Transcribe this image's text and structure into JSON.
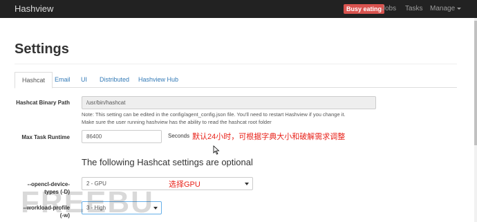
{
  "navbar": {
    "brand": "Hashview",
    "badge": "Busy eating",
    "links": {
      "jobs": "Jobs",
      "tasks": "Tasks",
      "manage": "Manage"
    }
  },
  "page": {
    "title": "Settings"
  },
  "tabs": [
    "Hashcat",
    "Email",
    "UI",
    "Distributed",
    "Hashview Hub"
  ],
  "form": {
    "binary_path": {
      "label": "Hashcat Binary Path",
      "value": "/usr/bin/hashcat",
      "help_line1": "Note: This setting can be edited in the config/agent_config.json file. You'll need to restart Hashview if you change it.",
      "help_line2": "Make sure the user running hashview has the ability to read the hashcat root folder"
    },
    "max_runtime": {
      "label": "Max Task Runtime",
      "value": "86400",
      "unit": "Seconds",
      "annotation": "默认24小时，可根据字典大小和破解需求调整"
    },
    "optional_heading": "The following Hashcat settings are optional",
    "device_types": {
      "label_line1": "--opencl-device-",
      "label_line2": "types (-D)",
      "value": "2 - GPU",
      "annotation": "选择GPU"
    },
    "workload": {
      "label_line1": "--workload-profile",
      "label_line2": "(-w)",
      "value": "3 - High"
    }
  },
  "watermark": "FREEBUF"
}
